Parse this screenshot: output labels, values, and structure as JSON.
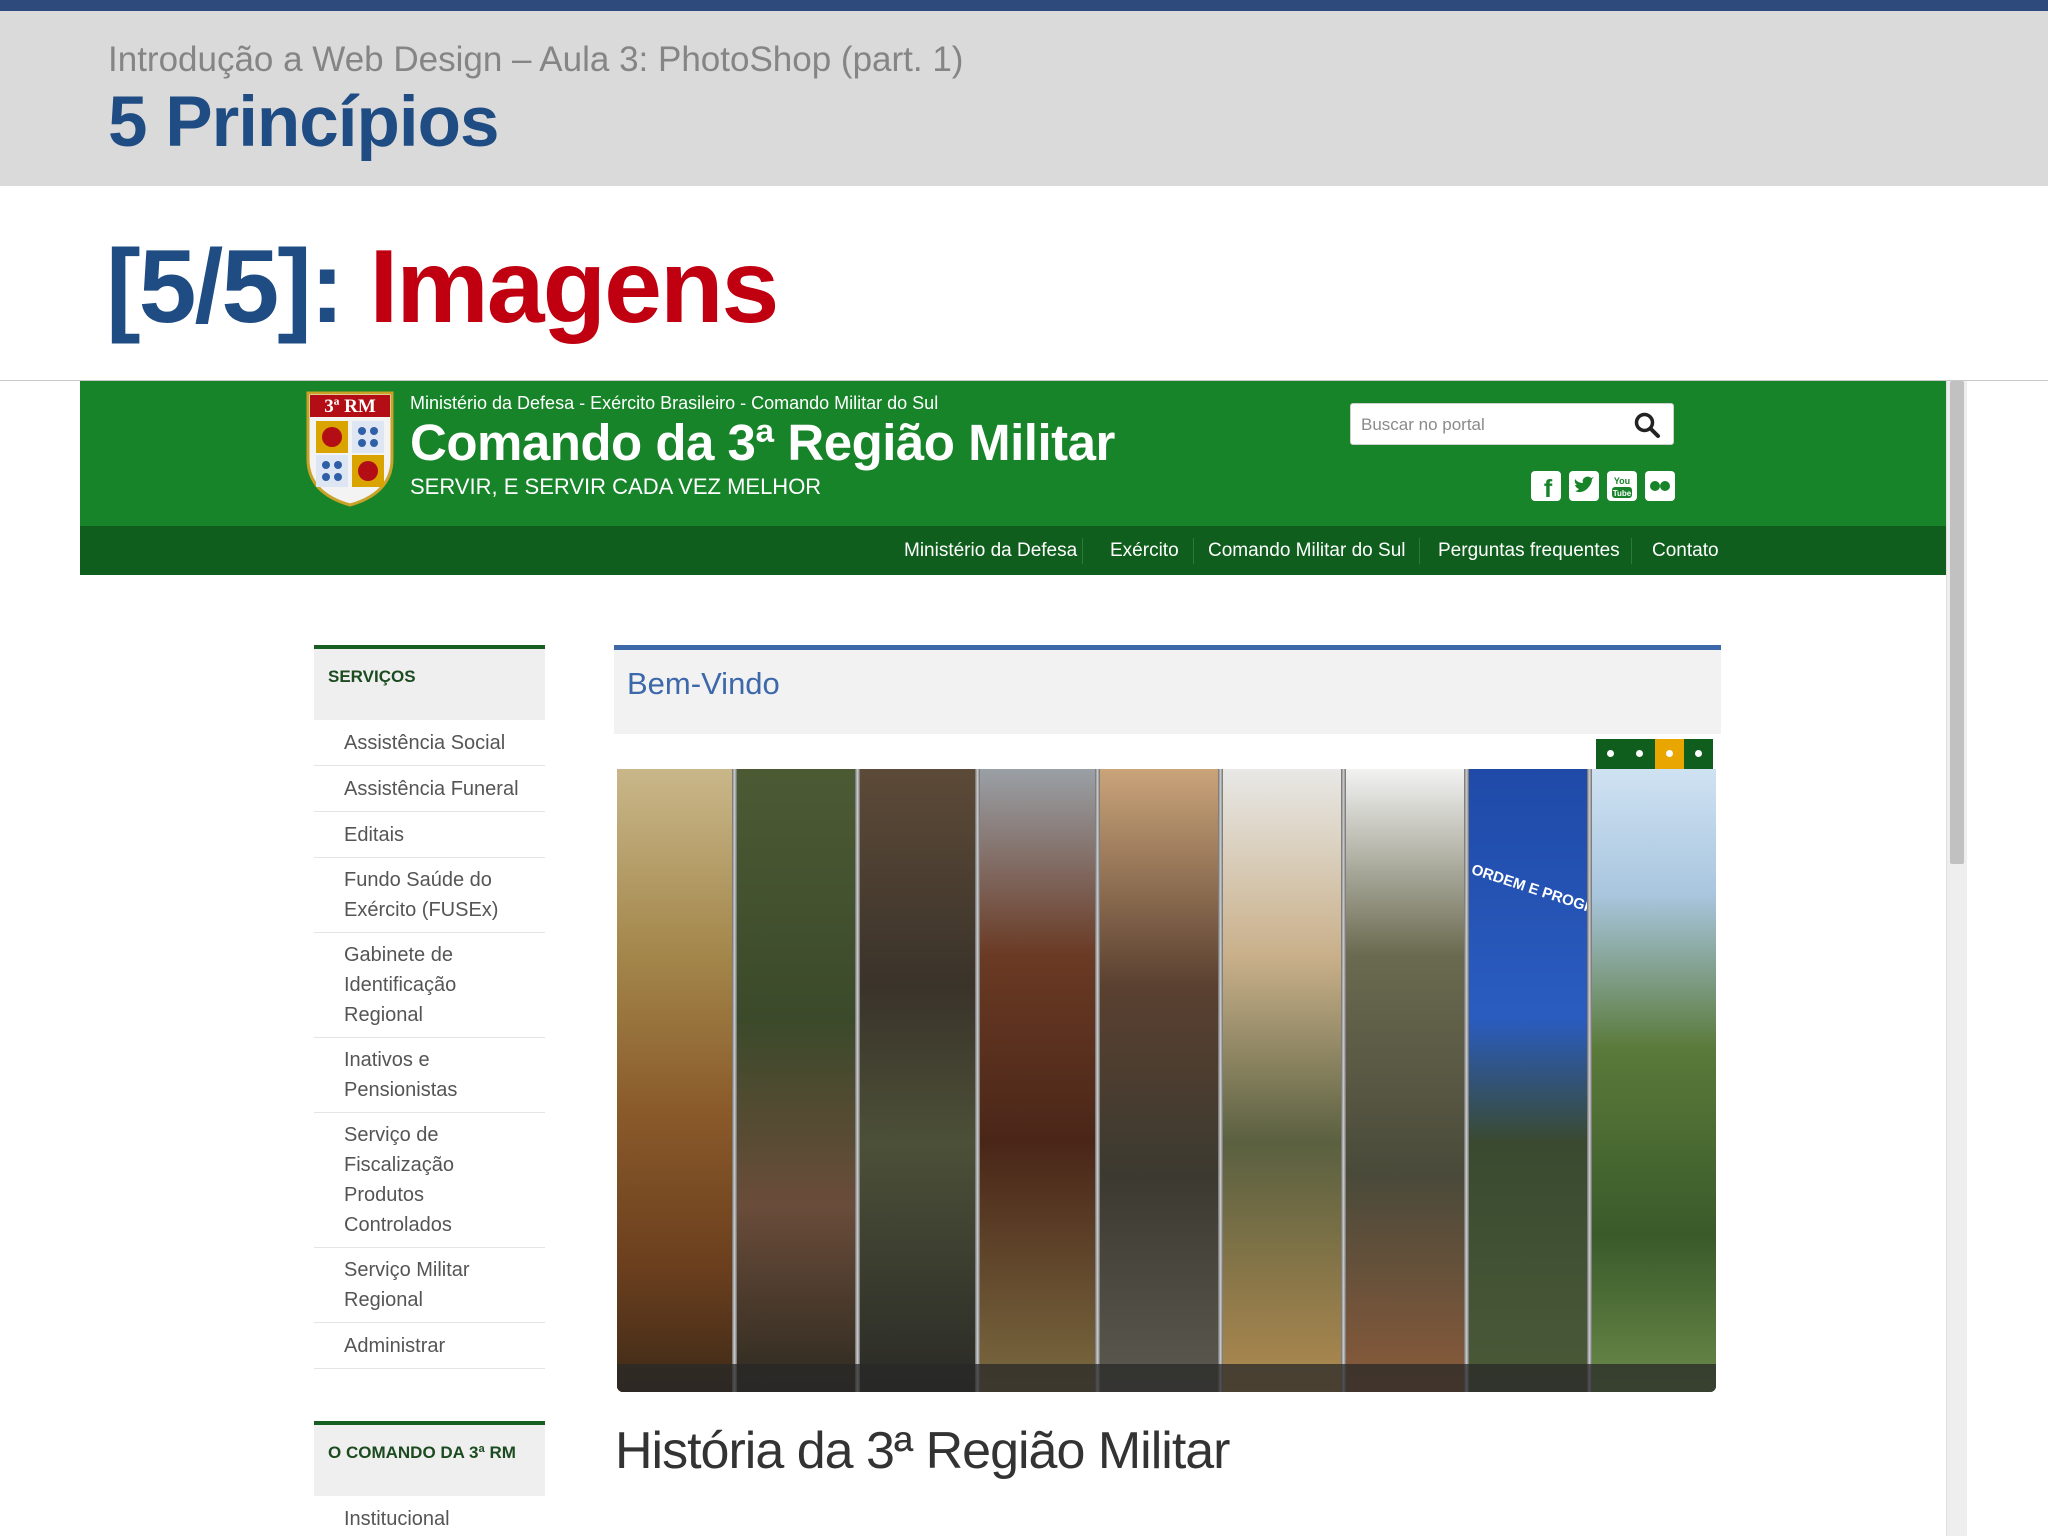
{
  "slide": {
    "subtitle": "Introdução a Web Design – Aula 3: PhotoShop (part. 1)",
    "title": "5 Princípios",
    "section_number": "[5/5]: ",
    "section_word": "Imagens"
  },
  "site": {
    "logo_text": "3ª RM",
    "top_line": "Ministério da Defesa - Exército Brasileiro - Comando Militar do Sul",
    "name": "Comando da 3ª Região Militar",
    "tagline": "SERVIR, E SERVIR CADA VEZ MELHOR",
    "search_placeholder": "Buscar no portal",
    "social": [
      {
        "icon": "facebook-icon",
        "label": "f"
      },
      {
        "icon": "twitter-icon",
        "label": "t"
      },
      {
        "icon": "youtube-icon",
        "label": "You Tube"
      },
      {
        "icon": "flickr-icon",
        "label": ""
      }
    ],
    "nav": [
      "Ministério da Defesa",
      "Exército",
      "Comando Militar do Sul",
      "Perguntas frequentes",
      "Contato"
    ]
  },
  "sidebar": {
    "services_heading": "SERVIÇOS",
    "services": [
      "Assistência Social",
      "Assistência Funeral",
      "Editais",
      "Fundo Saúde do Exército (FUSEx)",
      "Gabinete de Identificação Regional",
      "Inativos e Pensionistas",
      "Serviço de Fiscalização Produtos Controlados",
      "Serviço Militar Regional",
      "Administrar"
    ],
    "command_heading": "O COMANDO DA 3ª RM",
    "command": [
      "Institucional"
    ]
  },
  "content": {
    "welcome": "Bem-Vindo",
    "banner_flag_text": "ORDEM E PROGRESSO",
    "slider_active_index": 3,
    "history_title": "História da 3ª Região Militar"
  },
  "colors": {
    "slide_blue": "#1f4c83",
    "slide_red": "#c00010",
    "site_green": "#17842a",
    "site_dark_green": "#0f5e1d",
    "link_blue": "#3d68aa",
    "slider_active": "#e9a600"
  }
}
